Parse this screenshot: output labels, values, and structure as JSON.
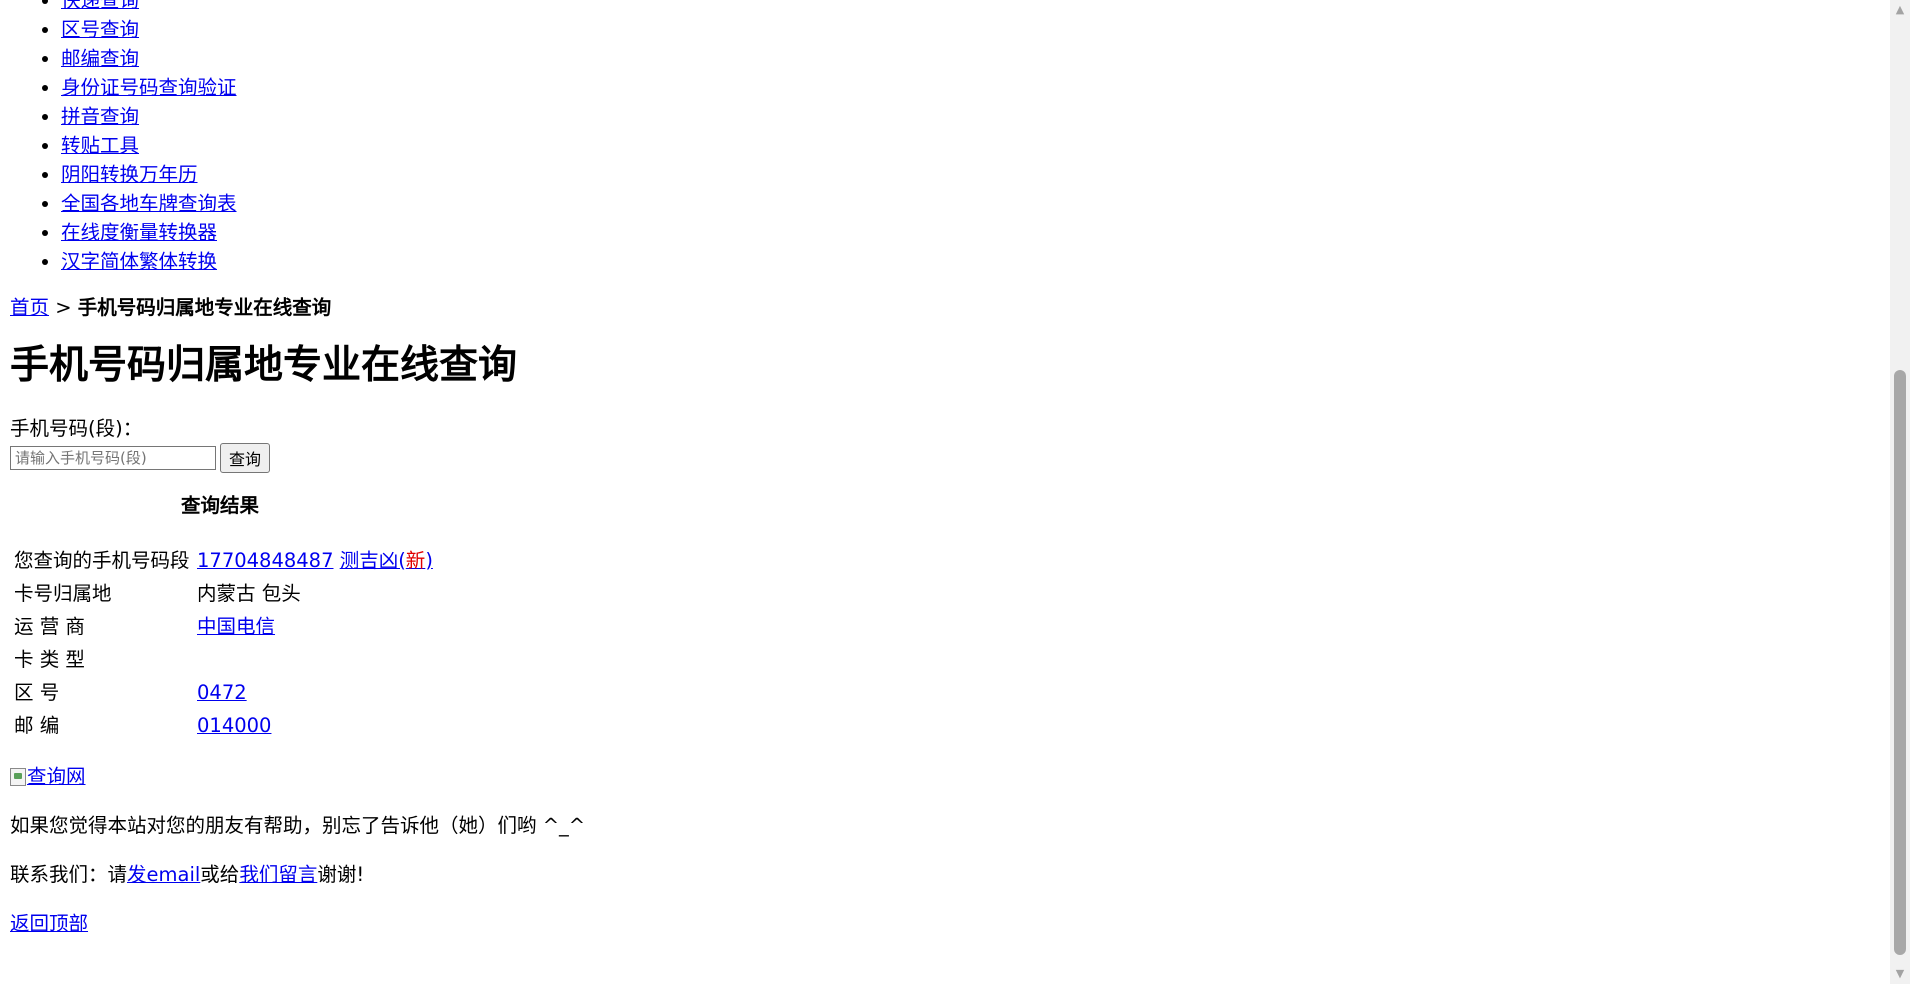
{
  "nav": {
    "items": [
      "快递查询",
      "区号查询",
      "邮编查询",
      "身份证号码查询验证",
      "拼音查询",
      "转贴工具",
      "阴阳转换万年历",
      "全国各地车牌查询表",
      "在线度衡量转换器",
      "汉字简体繁体转换"
    ]
  },
  "breadcrumb": {
    "home": "首页",
    "separator": " > ",
    "current": "手机号码归属地专业在线查询"
  },
  "page_title": "手机号码归属地专业在线查询",
  "form": {
    "label": "手机号码(段)：",
    "placeholder": "请输入手机号码(段)",
    "submit": "查询"
  },
  "result": {
    "title": "查询结果",
    "rows": [
      {
        "key": "您查询的手机号码段",
        "number": "17704848487",
        "fortune": "测吉凶(",
        "new": "新",
        "close": ")"
      },
      {
        "key": "卡号归属地",
        "value": "内蒙古 包头"
      },
      {
        "key": "运 营 商",
        "value": "中国电信"
      },
      {
        "key": "卡 类 型",
        "value": ""
      },
      {
        "key": "区 号",
        "value": "0472"
      },
      {
        "key": "邮 编",
        "value": "014000"
      }
    ]
  },
  "banner": {
    "alt": "查询网"
  },
  "share_text": "如果您觉得本站对您的朋友有帮助，别忘了告诉他（她）们哟 ^_^",
  "contact": {
    "prefix": "联系我们：请",
    "email": "发email",
    "middle": "或给",
    "message": "我们留言",
    "suffix": "谢谢!"
  },
  "back_to_top": "返回顶部",
  "scrollbar": {
    "up": "▲",
    "down": "▼"
  }
}
